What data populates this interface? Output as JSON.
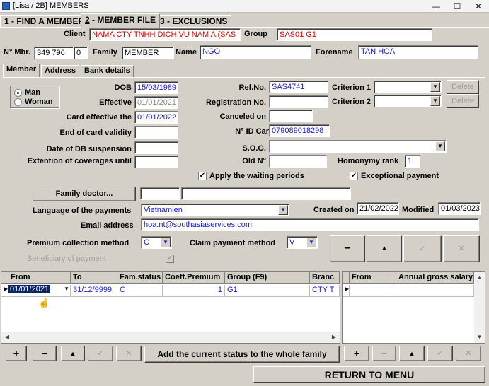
{
  "window": {
    "title": "[Lisa / 2B] MEMBERS",
    "minimize": "—",
    "maximize": "☐",
    "close": "✕"
  },
  "tabs": [
    {
      "num": "1",
      "label": " - FIND A MEMBER"
    },
    {
      "num": "2",
      "label": " - MEMBER FILE"
    },
    {
      "num": "3",
      "label": " - EXCLUSIONS"
    }
  ],
  "header": {
    "client_label": "Client",
    "client_value": "NAMA CTY TNHH DICH VU NAM A (SAS",
    "group_label": "Group",
    "group_value": "SAS01 G1",
    "mbr_label": "N° Mbr.",
    "mbr_value": "349 796",
    "mbr_suffix": "0",
    "family_label": "Family",
    "family_value": "MEMBER",
    "name_label": "Name",
    "name_value": "NGO",
    "forename_label": "Forename",
    "forename_value": "TAN HOA"
  },
  "subtabs": [
    "Member",
    "Address",
    "Bank details"
  ],
  "gender": {
    "man": "Man",
    "woman": "Woman"
  },
  "form": {
    "dob_label": "DOB",
    "dob": "15/03/1989",
    "effective_label": "Effective",
    "effective": "01/01/2021",
    "card_eff_label": "Card effective the",
    "card_eff": "01/01/2022",
    "end_card_label": "End of card validity",
    "end_card": "",
    "db_susp_label": "Date of DB suspension",
    "db_susp": "",
    "ext_cov_label": "Extention of coverages until",
    "ext_cov": "",
    "refno_label": "Ref.No.",
    "refno": "SAS4741",
    "regno_label": "Registration No.",
    "regno": "",
    "canceled_label": "Canceled on",
    "canceled": "",
    "idcard_label": "N° ID Car",
    "idcard": "079089018298",
    "sog_label": "S.O.G.",
    "sog": "",
    "oldno_label": "Old N°",
    "oldno": "",
    "homonymy_label": "Homonymy rank",
    "homonymy": "1",
    "crit1_label": "Criterion 1",
    "crit1": "",
    "crit2_label": "Criterion 2",
    "crit2": "",
    "delete1": "Delete",
    "delete2": "Delete",
    "waiting_label": "Apply the waiting periods",
    "exceptional_label": "Exceptional payment",
    "family_doctor_btn": "Family doctor...",
    "lang_label": "Language of the payments",
    "lang": "Vietnamien",
    "created_label": "Created on",
    "created": "21/02/2022",
    "modified_label": "Modified",
    "modified": "01/03/2023",
    "email_label": "Email address",
    "email": "hoa.nt@southasiaservices.com",
    "premium_label": "Premium collection method",
    "premium": "C",
    "claim_label": "Claim payment method",
    "claim": "V",
    "beneficiary_label": "Beneficiary of payment"
  },
  "status_grid": {
    "headers": [
      "From",
      "To",
      "Fam.status",
      "Coeff.Premium",
      "Group (F9)",
      "Branc"
    ],
    "rows": [
      {
        "from": "01/01/2021",
        "to": "31/12/9999",
        "fam": "C",
        "coeff": "1",
        "group": "G1",
        "branch": "CTY T"
      }
    ]
  },
  "salary_grid": {
    "headers": [
      "From",
      "Annual gross salary"
    ]
  },
  "buttons": {
    "add": "+",
    "remove": "−",
    "up": "▲",
    "add_current": "Add the current status to the whole family",
    "return_menu": "RETURN TO MENU"
  }
}
